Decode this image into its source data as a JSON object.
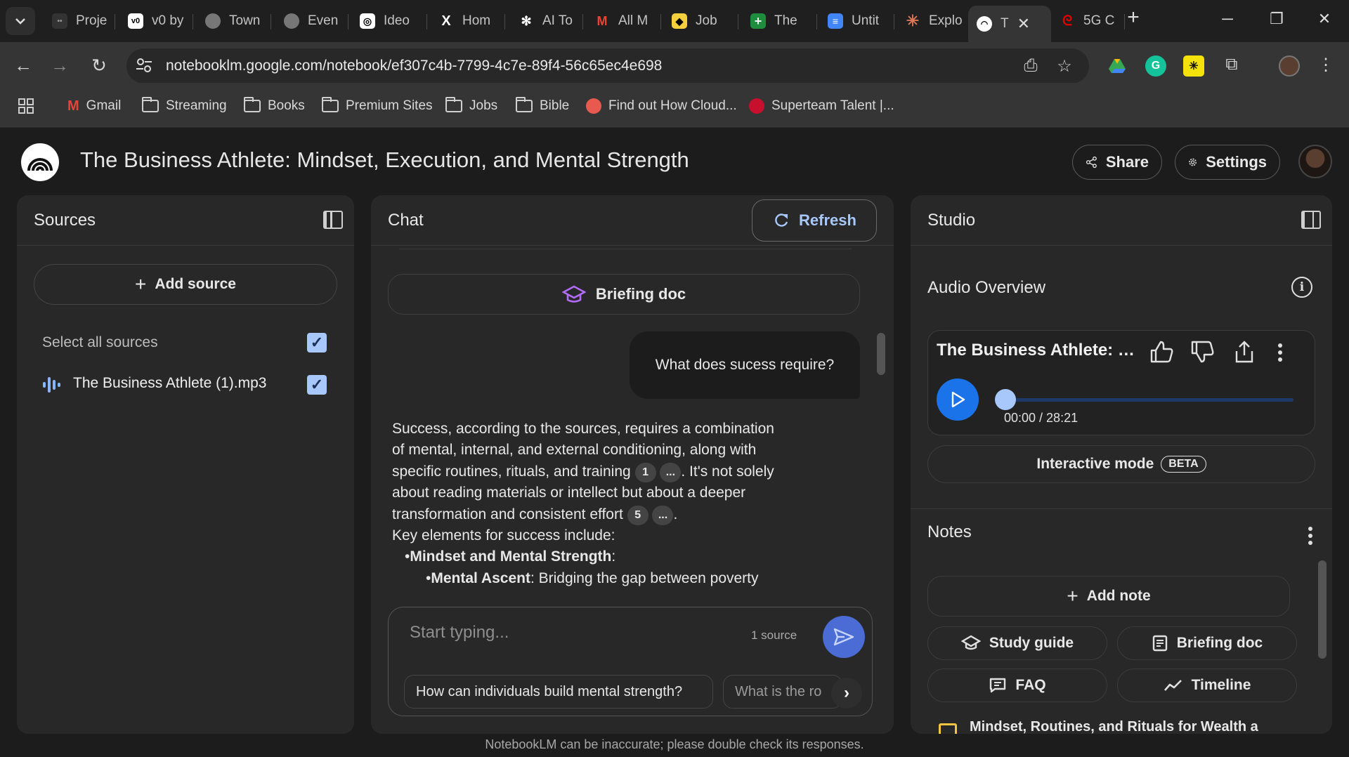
{
  "browser": {
    "tabs": [
      {
        "label": "Proje",
        "icon": "project-favicon"
      },
      {
        "label": "v0 by",
        "icon": "v0-favicon"
      },
      {
        "label": "Town",
        "icon": "globe-favicon"
      },
      {
        "label": "Even",
        "icon": "globe-favicon"
      },
      {
        "label": "Ideo",
        "icon": "ideogram-favicon"
      },
      {
        "label": "Hom",
        "icon": "x-favicon"
      },
      {
        "label": "AI To",
        "icon": "openai-favicon"
      },
      {
        "label": "All M",
        "icon": "gmail-favicon"
      },
      {
        "label": "Job",
        "icon": "job-favicon"
      },
      {
        "label": "The",
        "icon": "sheets-favicon"
      },
      {
        "label": "Untit",
        "icon": "docs-favicon"
      },
      {
        "label": "Explo",
        "icon": "claude-favicon"
      },
      {
        "label": "T",
        "icon": "notebooklm-favicon",
        "active": true
      },
      {
        "label": "5G C",
        "icon": "airtel-favicon"
      }
    ],
    "url": "notebooklm.google.com/notebook/ef307c4b-7799-4c7e-89f4-56c65ec4e698",
    "bookmarks": [
      {
        "label": "Gmail",
        "icon": "gmail-icon"
      },
      {
        "label": "Streaming",
        "icon": "folder-icon"
      },
      {
        "label": "Books",
        "icon": "folder-icon"
      },
      {
        "label": "Premium Sites",
        "icon": "folder-icon"
      },
      {
        "label": "Jobs",
        "icon": "folder-icon"
      },
      {
        "label": "Bible",
        "icon": "folder-icon"
      },
      {
        "label": "Find out How Cloud...",
        "icon": "cloud-favicon"
      },
      {
        "label": "Superteam Talent |...",
        "icon": "superteam-favicon"
      }
    ]
  },
  "header": {
    "title": "The Business Athlete: Mindset, Execution, and Mental Strength",
    "share_label": "Share",
    "settings_label": "Settings"
  },
  "sources": {
    "title": "Sources",
    "add_source_label": "Add source",
    "select_all_label": "Select all sources",
    "items": [
      {
        "label": "The Business Athlete (1).mp3",
        "checked": true
      }
    ]
  },
  "chat": {
    "title": "Chat",
    "refresh_label": "Refresh",
    "briefing_label": "Briefing doc",
    "user_message": "What does sucess require?",
    "answer": {
      "p1": "Success, according to the sources, requires a combination of mental, internal, and external conditioning, along with specific routines, rituals, and training",
      "cite1": "1",
      "cite2": "...",
      "p2": ". It's not solely about reading materials or intellect but about a deeper transformation and consistent effort",
      "cite3": "5",
      "cite4": "...",
      "p3": ".",
      "key_elements": "Key elements for success include:",
      "bullet1": "Mindset and Mental Strength",
      "bullet1_suffix": ":",
      "sub1_bold": "Mental Ascent",
      "sub1_text": ": Bridging the gap between poverty"
    },
    "input_placeholder": "Start typing...",
    "source_count": "1 source",
    "suggestions": [
      "How can individuals build mental strength?",
      "What is the ro"
    ]
  },
  "studio": {
    "title": "Studio",
    "audio_overview_label": "Audio Overview",
    "audio_title": "The Business Athlete: M...",
    "time": "00:00 / 28:21",
    "progress": 0.0,
    "interactive_label": "Interactive mode",
    "beta_label": "BETA",
    "notes_label": "Notes",
    "add_note_label": "Add note",
    "study_guide_label": "Study guide",
    "briefing_doc_label": "Briefing doc",
    "faq_label": "FAQ",
    "timeline_label": "Timeline",
    "note_item": "Mindset, Routines, and Rituals for Wealth a"
  },
  "footer": "NotebookLM can be inaccurate; please double check its responses.",
  "colors": {
    "accent_blue": "#a8c7fa",
    "play_blue": "#1a73e8",
    "send_blue": "#4a6cd4",
    "briefing_purple": "#a142f4",
    "note_yellow": "#f5c542"
  }
}
